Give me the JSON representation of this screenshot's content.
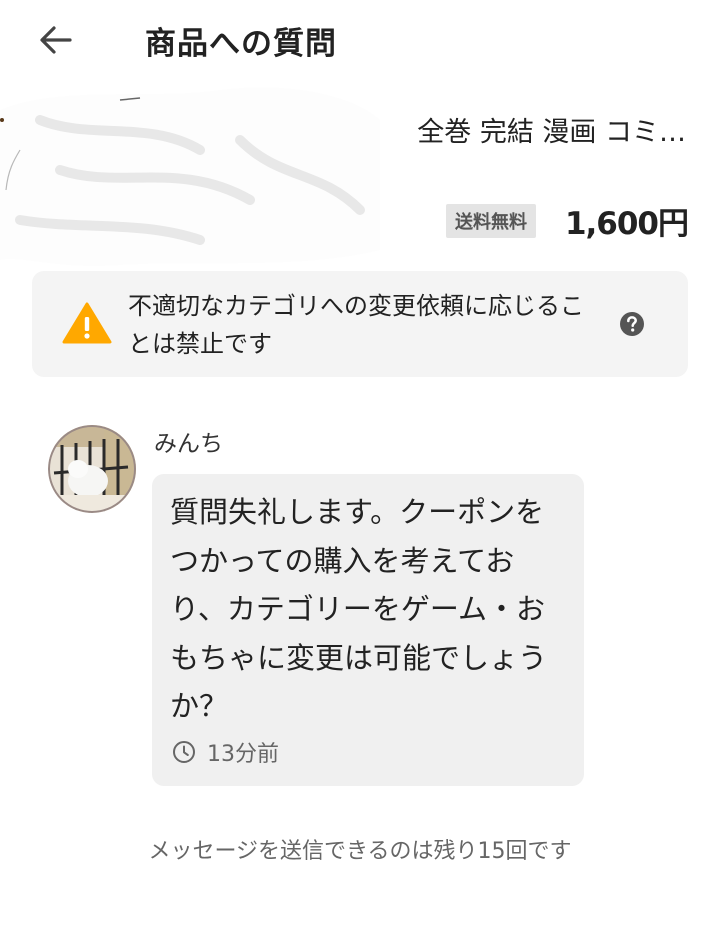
{
  "header": {
    "title": "商品への質問",
    "back_icon": "arrow-left-icon"
  },
  "product": {
    "name": "全巻 完結 漫画 コミ…",
    "shipping_badge": "送料無料",
    "price": "1,600円"
  },
  "notice": {
    "icon": "warning-icon",
    "text": "不適切なカテゴリへの変更依頼に応じることは禁止です",
    "help_icon": "help-icon",
    "colors": {
      "warning": "#ffa800",
      "help": "#555555"
    }
  },
  "message": {
    "username": "みんち",
    "text": "質問失礼します。クーポンをつかっての購入を考えており、カテゴリーをゲーム・おもちゃに変更は可能でしょうか？",
    "time_icon": "clock-icon",
    "time": "13分前"
  },
  "footer": {
    "remaining_text": "メッセージを送信できるのは残り15回です"
  }
}
